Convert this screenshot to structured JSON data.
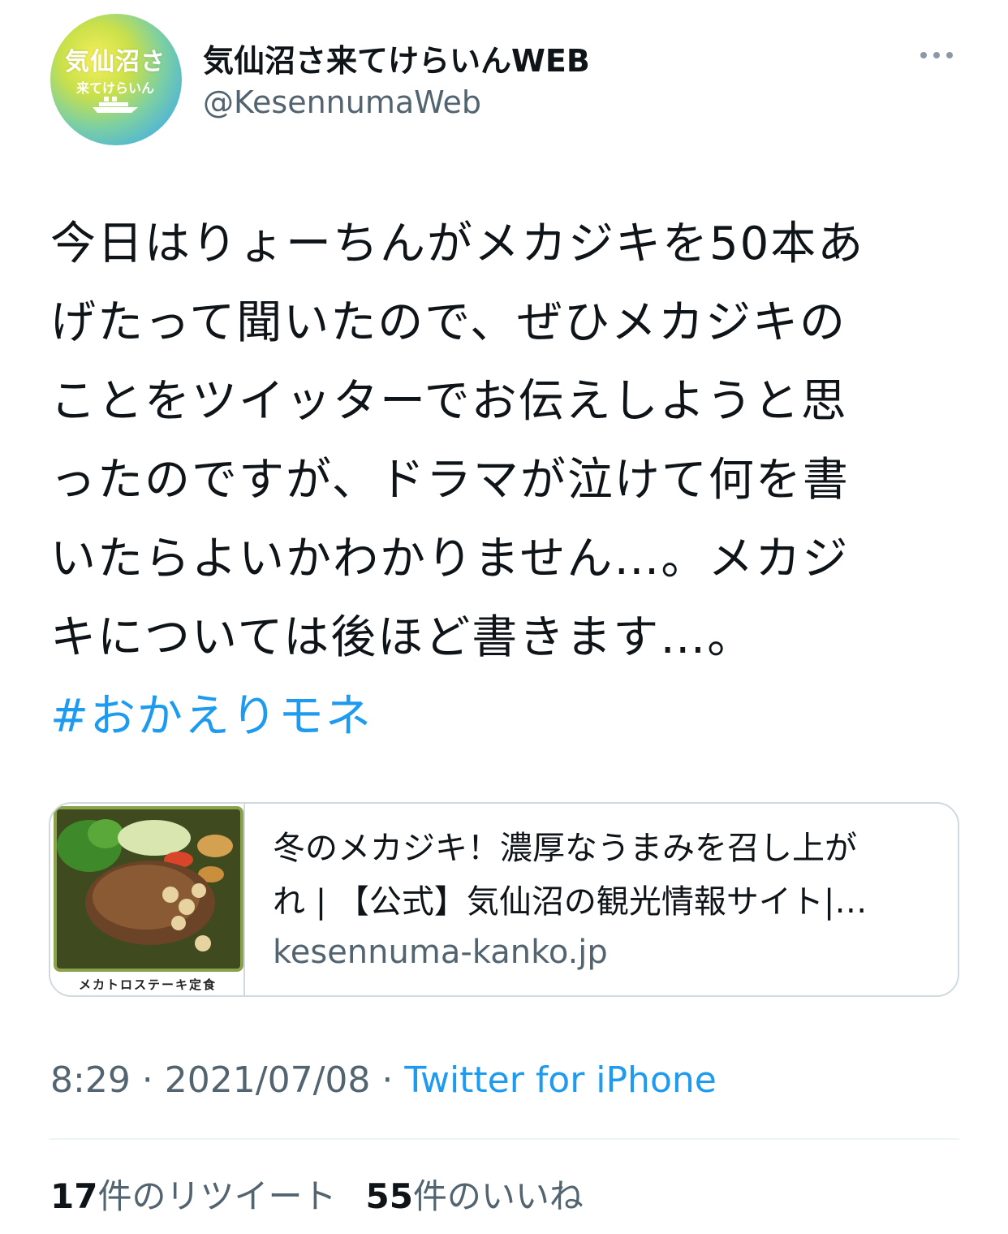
{
  "account": {
    "display_name": "気仙沼さ来てけらいんWEB",
    "handle": "@KesennumaWeb",
    "avatar_text_line1": "気仙沼さ",
    "avatar_text_line2": "来てけらいん"
  },
  "tweet": {
    "lines": [
      "今日はりょーちんがメカジキを50本あ",
      "げたって聞いたので、ぜひメカジキの",
      "ことをツイッターでお伝えしようと思",
      "ったのですが、ドラマが泣けて何を書",
      "いたらよいかわかりません…。メカジ",
      "キについては後ほど書きます…。"
    ],
    "hashtag": "#おかえりモネ"
  },
  "link_card": {
    "thumbnail_caption": "メカトロステーキ定食",
    "title_line1": "冬のメカジキ！濃厚なうまみを召し上が",
    "title_line2": "れ | 【公式】気仙沼の観光情報サイト|…",
    "domain": "kesennuma-kanko.jp"
  },
  "meta": {
    "time": "8:29",
    "separator": " · ",
    "date": "2021/07/08",
    "source": "Twitter for iPhone"
  },
  "stats": {
    "retweets_count": "17",
    "retweets_label": "件のリツイート",
    "likes_count": "55",
    "likes_label": "件のいいね"
  },
  "colors": {
    "link": "#1d9bf0",
    "secondary_text": "#536471",
    "border": "#cfd9de"
  },
  "icons": {
    "more": "more-horizontal-icon"
  }
}
